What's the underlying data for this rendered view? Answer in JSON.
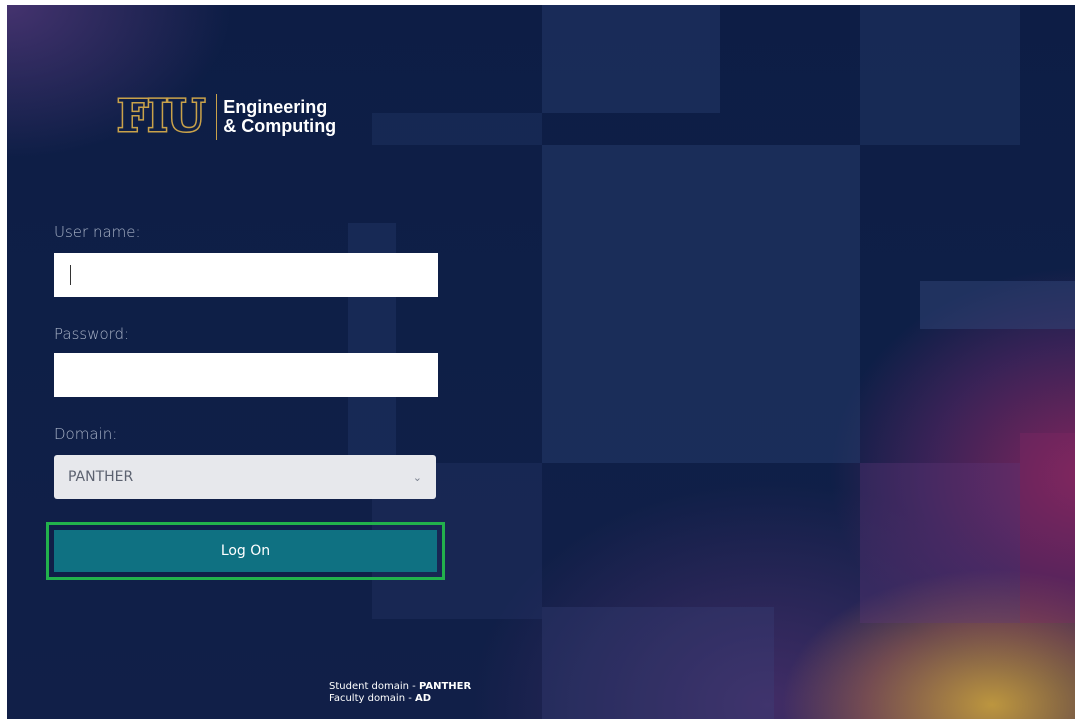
{
  "logo": {
    "mark": "FIU",
    "line1": "Engineering",
    "line2": "& Computing",
    "gold": "#c9a24a"
  },
  "form": {
    "username_label": "User name:",
    "username_value": "",
    "password_label": "Password:",
    "password_value": "",
    "domain_label": "Domain:",
    "domain_selected": "PANTHER",
    "logon_label": "Log On"
  },
  "footer": {
    "student_prefix": "Student domain - ",
    "student_domain": "PANTHER",
    "faculty_prefix": "Faculty domain - ",
    "faculty_domain": "AD"
  },
  "colors": {
    "background": "#0e1f47",
    "button": "#0f7182",
    "highlight_outline": "#22b14c"
  },
  "icons": {
    "domain_dropdown": "chevron-down-icon"
  }
}
